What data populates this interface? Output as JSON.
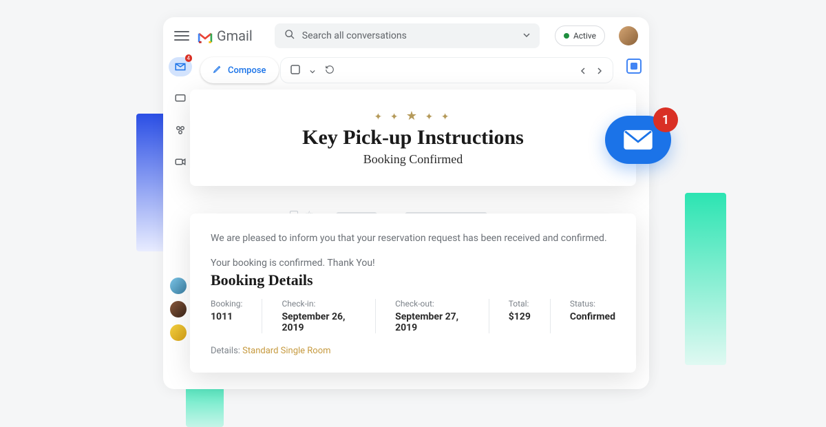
{
  "gmail": {
    "brand": "Gmail",
    "search_placeholder": "Search all conversations",
    "active_label": "Active",
    "compose": "Compose",
    "rail_badge": "4"
  },
  "email_header": {
    "title": "Key Pick-up Instructions",
    "subtitle": "Booking Confirmed"
  },
  "notif": {
    "count": "1"
  },
  "booking": {
    "intro": "We are pleased to inform you that your reservation request has been received and confirmed.",
    "thanks": "Your booking is confirmed. Thank You!",
    "section_title": "Booking Details",
    "cols": [
      {
        "label": "Booking:",
        "value": "1011"
      },
      {
        "label": "Check-in:",
        "value": "September 26, 2019"
      },
      {
        "label": "Check-out:",
        "value": "September 27, 2019"
      },
      {
        "label": "Total:",
        "value": "$129"
      },
      {
        "label": "Status:",
        "value": "Confirmed"
      }
    ],
    "details_label": "Details:",
    "details_link": "Standard Single Room"
  }
}
